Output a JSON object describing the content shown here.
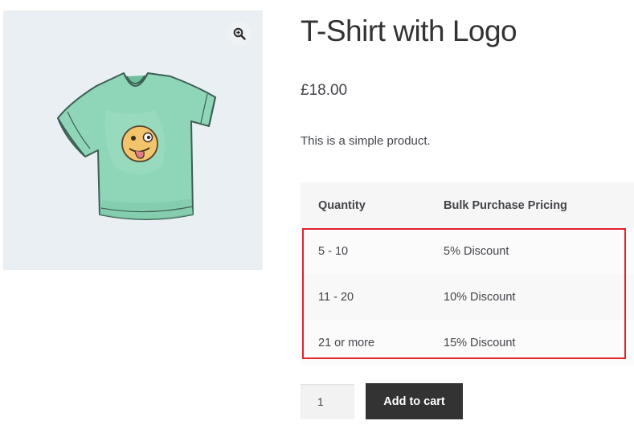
{
  "product": {
    "title": "T-Shirt with Logo",
    "price": "£18.00",
    "description": "This is a simple product.",
    "image_icon": "tshirt-logo-image",
    "zoom_icon": "zoom-in-icon"
  },
  "pricing_table": {
    "headers": {
      "quantity": "Quantity",
      "pricing": "Bulk Purchase Pricing"
    },
    "rows": [
      {
        "quantity": "5 - 10",
        "pricing": "5% Discount"
      },
      {
        "quantity": "11 - 20",
        "pricing": "10% Discount"
      },
      {
        "quantity": "21 or more",
        "pricing": "15% Discount"
      }
    ]
  },
  "cart": {
    "quantity_value": "1",
    "add_to_cart_label": "Add to cart"
  },
  "colors": {
    "highlight": "#e2222b",
    "button_bg": "#333333",
    "gallery_bg": "#e9eff2",
    "shirt": "#8fd6b8"
  }
}
